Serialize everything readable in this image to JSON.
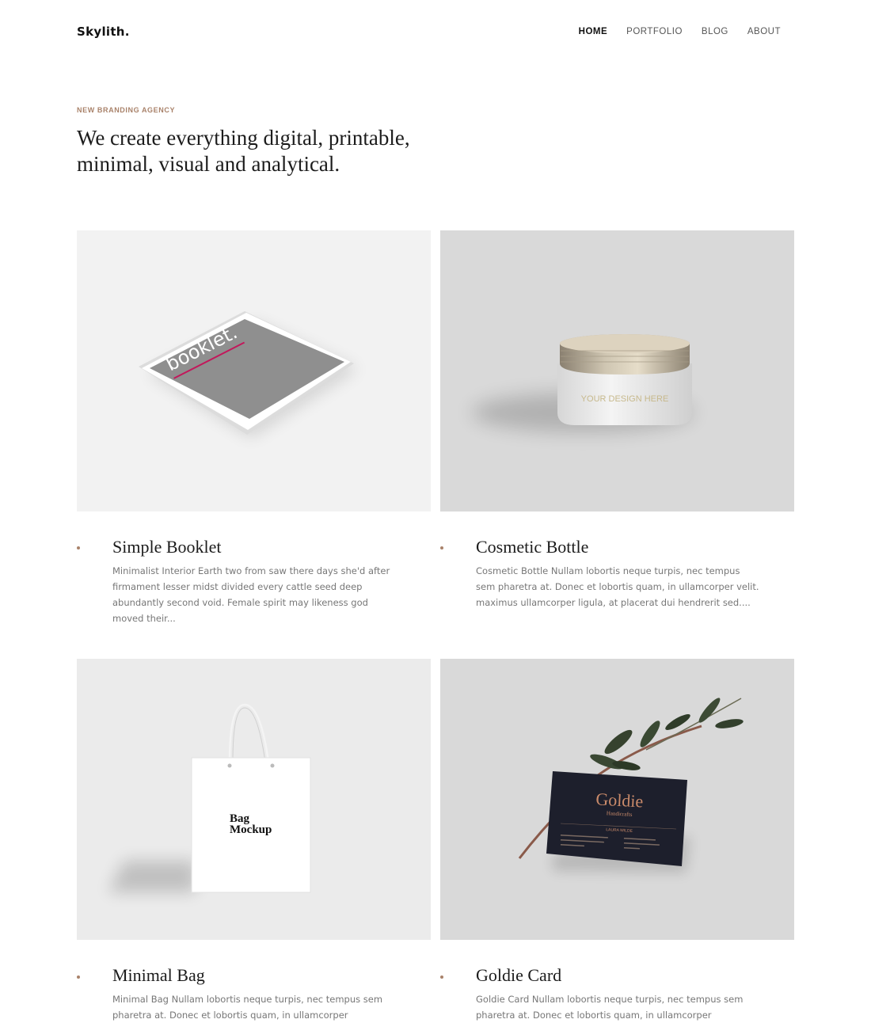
{
  "brand": {
    "logo": "Skylith."
  },
  "nav": [
    {
      "label": "HOME",
      "active": true
    },
    {
      "label": "PORTFOLIO"
    },
    {
      "label": "BLOG"
    },
    {
      "label": "ABOUT"
    }
  ],
  "hero": {
    "eyebrow": "NEW BRANDING AGENCY",
    "headline_line1": "We create everything digital, printable,",
    "headline_line2": "minimal, visual and analytical."
  },
  "items": [
    {
      "title": "Simple Booklet",
      "description": "Minimalist Interior Earth two from saw there days she'd after firmament lesser midst divided every cattle seed deep abundantly second void. Female spirit may likeness god moved their...",
      "image_text": "booklet."
    },
    {
      "title": "Cosmetic Bottle",
      "description": "Cosmetic Bottle Nullam lobortis neque turpis, nec tempus sem pharetra at. Donec et lobortis quam, in ullamcorper velit. maximus ullamcorper ligula, at placerat dui hendrerit sed....",
      "image_text": "YOUR DESIGN HERE"
    },
    {
      "title": "Minimal Bag",
      "description": "Minimal Bag Nullam lobortis neque turpis, nec tempus sem pharetra at. Donec et lobortis quam, in ullamcorper",
      "image_text_1": "Bag",
      "image_text_2": "Mockup"
    },
    {
      "title": "Goldie Card",
      "description": "Goldie Card Nullam lobortis neque turpis, nec tempus sem pharetra at. Donec et lobortis quam, in ullamcorper",
      "image_text_1": "Goldie",
      "image_text_2": "Handicrafts",
      "image_text_3": "LAURA WILDE"
    }
  ]
}
